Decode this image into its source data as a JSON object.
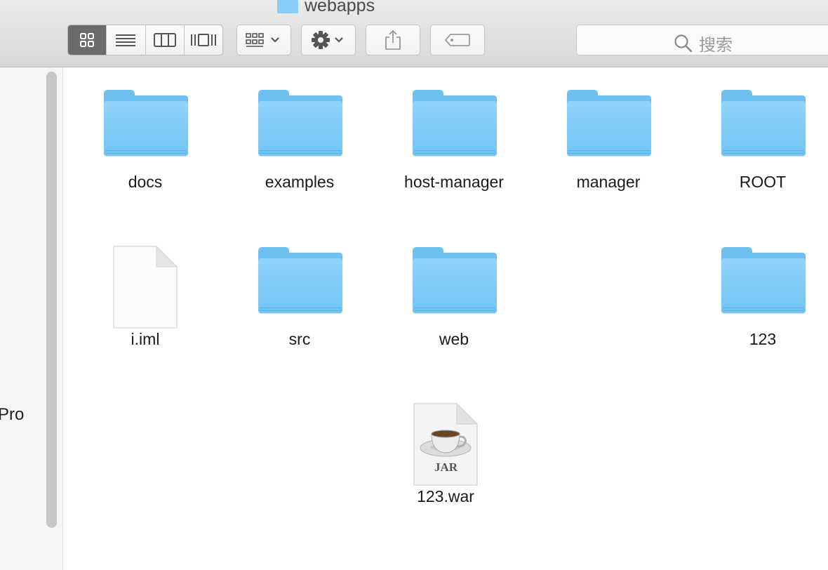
{
  "window": {
    "title": "webapps"
  },
  "toolbar": {
    "view_icon": "icon-view-grid-icon",
    "list_icon": "list-view-icon",
    "column_icon": "column-view-icon",
    "coverflow_icon": "cover-flow-icon",
    "arrange_icon": "arrange-icon",
    "action_icon": "gear-icon",
    "share_icon": "share-icon",
    "tag_icon": "tag-icon"
  },
  "search": {
    "placeholder": "搜索"
  },
  "sidebar": {
    "partial_label": "Pro"
  },
  "files": [
    {
      "name": "docs",
      "kind": "folder"
    },
    {
      "name": "examples",
      "kind": "folder"
    },
    {
      "name": "host-manager",
      "kind": "folder"
    },
    {
      "name": "manager",
      "kind": "folder"
    },
    {
      "name": "ROOT",
      "kind": "folder"
    },
    {
      "name": "i.iml",
      "kind": "document"
    },
    {
      "name": "src",
      "kind": "folder"
    },
    {
      "name": "web",
      "kind": "folder"
    },
    {
      "name": "123",
      "kind": "folder"
    },
    {
      "name": "123.war",
      "kind": "jar",
      "badge": "JAR"
    }
  ]
}
